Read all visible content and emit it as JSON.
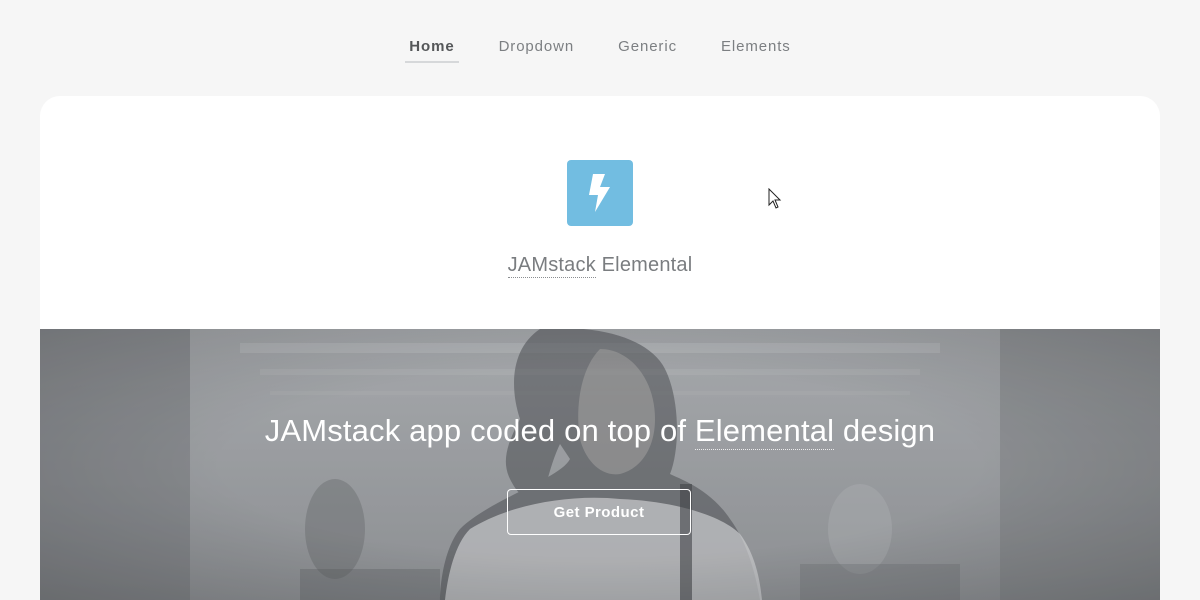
{
  "nav": {
    "items": [
      {
        "label": "Home",
        "active": true
      },
      {
        "label": "Dropdown",
        "active": false
      },
      {
        "label": "Generic",
        "active": false
      },
      {
        "label": "Elements",
        "active": false
      }
    ]
  },
  "header": {
    "logo_icon": "lightning-bolt-icon",
    "logo_color": "#72bde1",
    "title_link": "JAMstack",
    "title_rest": " Elemental"
  },
  "hero": {
    "headline_before": "JAMstack app coded on top of ",
    "headline_link": "Elemental",
    "headline_after": " design",
    "button_label": "Get Product"
  }
}
